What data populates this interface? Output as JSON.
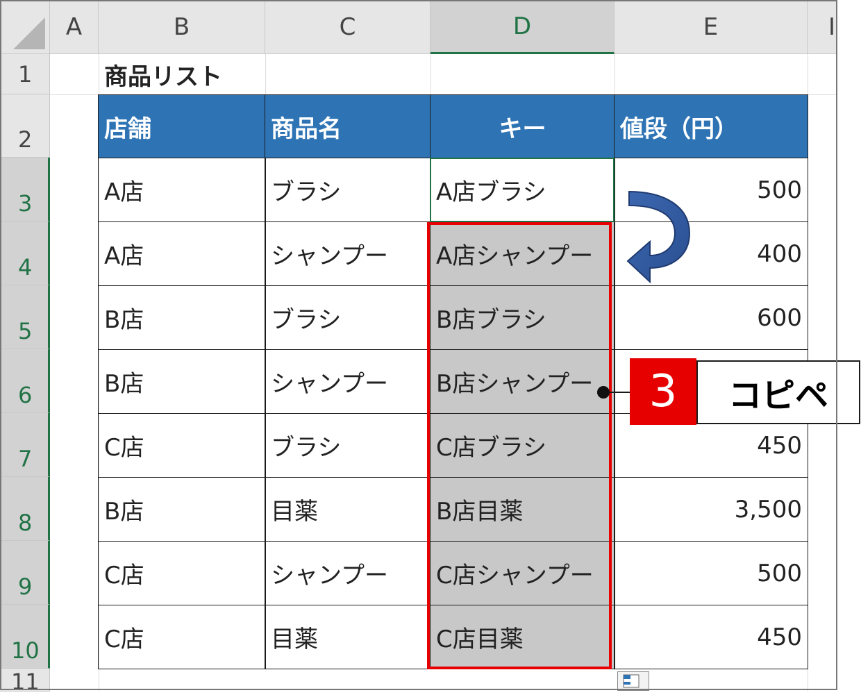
{
  "sheet": {
    "columns": [
      "A",
      "B",
      "C",
      "D",
      "E",
      "I"
    ],
    "rows": [
      "1",
      "2",
      "3",
      "4",
      "5",
      "6",
      "7",
      "8",
      "9",
      "10",
      "11"
    ],
    "title": "商品リスト",
    "headers": [
      "店舗",
      "商品名",
      "キー",
      "値段（円）"
    ],
    "data": [
      [
        "A店",
        "ブラシ",
        "A店ブラシ",
        "500"
      ],
      [
        "A店",
        "シャンプー",
        "A店シャンプー",
        "400"
      ],
      [
        "B店",
        "ブラシ",
        "B店ブラシ",
        "600"
      ],
      [
        "B店",
        "シャンプー",
        "B店シャンプー",
        ""
      ],
      [
        "C店",
        "ブラシ",
        "C店ブラシ",
        "450"
      ],
      [
        "B店",
        "目薬",
        "B店目薬",
        "3,500"
      ],
      [
        "C店",
        "シャンプー",
        "C店シャンプー",
        "500"
      ],
      [
        "C店",
        "目薬",
        "C店目薬",
        "450"
      ]
    ]
  },
  "callout": {
    "number": "3",
    "label": "コピペ"
  },
  "colors": {
    "header_bg": "#2e74b5",
    "selection": "#c8c8c8",
    "highlight": "#e60000",
    "excel_green": "#217346"
  },
  "icons": {
    "arrow": "curved-down-arrow-icon",
    "paste": "paste-options-icon"
  }
}
